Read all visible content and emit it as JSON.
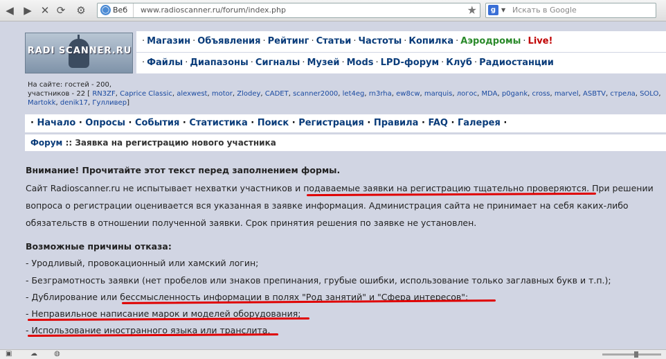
{
  "browser": {
    "address_tag": "Веб",
    "url": "www.radioscanner.ru/forum/index.php",
    "search_placeholder": "Искать в Google",
    "search_engine_letter": "g"
  },
  "site": {
    "logo_text": "RADI  SCANNER.RU",
    "menu1": [
      "Магазин",
      "Объявления",
      "Рейтинг",
      "Статьи",
      "Частоты",
      "Копилка",
      "Аэродромы",
      "Live!"
    ],
    "menu2": [
      "Файлы",
      "Диапазоны",
      "Сигналы",
      "Музей",
      "Mods",
      "LPD-форум",
      "Клуб",
      "Радиостанции"
    ],
    "menu_colors": {
      "link": "#0a3c7a",
      "green": "#2a8a2a",
      "red": "#c00000"
    }
  },
  "online": {
    "guests": "На сайте: гостей - 200,",
    "members_prefix": "участников - 22 [",
    "members": [
      "RN3ZF",
      "Caprice Classic",
      "alexwest",
      "motor",
      "Zlodey",
      "CADET",
      "scanner2000",
      "let4eg",
      "rn3rha",
      "ew8cw",
      "marquis",
      "логос",
      "MDA",
      "p0gank",
      "cross",
      "marvel",
      "ASBTV",
      "стрела",
      "SOLO",
      "Martokk",
      "denik17",
      "Гулливер"
    ],
    "members_suffix": "]"
  },
  "nav": [
    "Начало",
    "Опросы",
    "События",
    "Статистика",
    "Поиск",
    "Регистрация",
    "Правила",
    "FAQ",
    "Галерея"
  ],
  "breadcrumb": {
    "forum": "Форум",
    "sep": "::",
    "page": "Заявка на регистрацию нового участника"
  },
  "content": {
    "warning_title": "Внимание! Прочитайте этот текст перед заполнением формы.",
    "p1_a": "Сайт Radioscanner.ru не испытывает нехватки участников и ",
    "p1_u": "подаваемые заявки на регистрацию тщательно проверяются",
    "p1_b": ". При решении",
    "p2": "вопроса о регистрации оценивается вся указанная в заявке информация. Администрация сайта не принимает на себя каких-либо",
    "p3": "обязательств в отношении полученной заявки. Срок принятия решения по заявке не установлен.",
    "reasons_title": "Возможные причины отказа:",
    "r1": "- Уродливый, провокационный или хамский логин;",
    "r2": "- Безграмотность заявки (нет пробелов или знаков препинания, грубые ошибки, использование только заглавных букв и т.п.);",
    "r3": "- Дублирование или бессмысленность информации в полях \"Род занятий\" и \"Сфера интересов\";",
    "r4": "- Неправильное написание марок и моделей оборудования;",
    "r5": "- Использование иностранного языка или транслита."
  }
}
